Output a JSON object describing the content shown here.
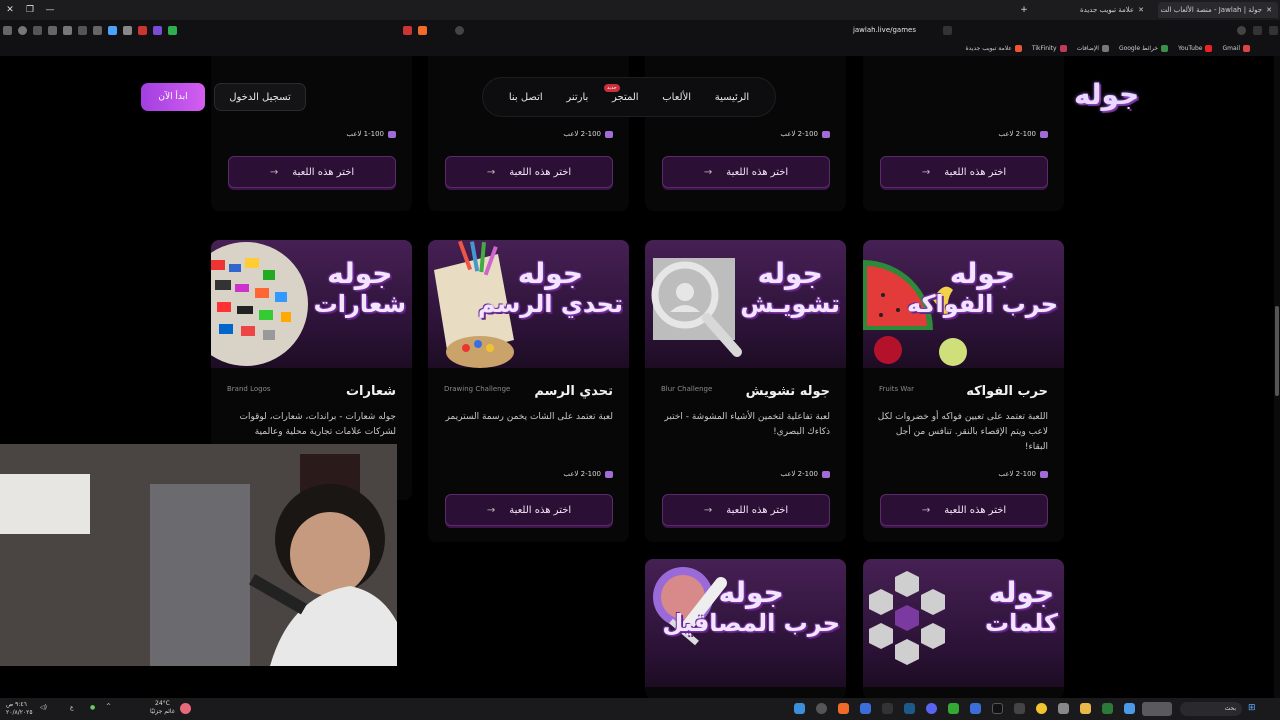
{
  "browser": {
    "active_tab_title": "جولة | Jawlah - منصة الألعاب الت",
    "other_tab_title": "علامة تبويب جديدة",
    "address": "jawlah.live/games",
    "bookmarks": [
      "Gmail",
      "YouTube",
      "خرائط Google",
      "الإضافات",
      "TikFinity",
      "علامة تبويب جديدة"
    ]
  },
  "header": {
    "brand": "جوله",
    "nav": [
      "الرئيسية",
      "الألعاب",
      "المتجر",
      "بارتنر",
      "اتصل بنا"
    ],
    "store_badge": "جديد",
    "login_label": "تسجيل الدخول",
    "start_label": "ابدأ الآن"
  },
  "choose_label": "اختر هذه اللعبة",
  "top_row": [
    {
      "players": "1-100 لاعب"
    },
    {
      "players": "2-100 لاعب"
    },
    {
      "players": "2-100 لاعب"
    },
    {
      "players": "2-100 لاعب"
    }
  ],
  "games": [
    {
      "title": "حرب الفواكه",
      "en": "Fruits War",
      "logo_line1": "جوله",
      "logo_line2": "حرب الفواكه",
      "desc": "اللعبة تعتمد على تعيين فواكه أو خضروات لكل لاعب ويتم الإقصاء بالنقر. تنافس من أجل البقاء!",
      "players": "2-100 لاعب"
    },
    {
      "title": "جوله تشويش",
      "en": "Blur Challenge",
      "logo_line1": "جوله",
      "logo_line2": "تشويـش",
      "desc": "لعبة تفاعلية لتخمين الأشياء المشوشة - اختبر ذكاءك البصري!",
      "players": "2-100 لاعب"
    },
    {
      "title": "تحدي الرسم",
      "en": "Drawing Challenge",
      "logo_line1": "جوله",
      "logo_line2": "تحدي الرسم",
      "desc": "لعبة تعتمد على الشات يخمن رسمة الستريمر",
      "players": "2-100 لاعب"
    },
    {
      "title": "شعارات",
      "en": "Brand Logos",
      "logo_line1": "جوله",
      "logo_line2": "شعارات",
      "desc": "جوله شعارات - براندات، شعارات، لوقوات لشركات علامات تجارية محلية وعالمية",
      "players": ""
    }
  ],
  "bottom_row": [
    {
      "logo_line1": "جوله",
      "logo_line2": "كلمات"
    },
    {
      "logo_line1": "جوله",
      "logo_line2": "حرب المصاقيل"
    }
  ],
  "taskbar": {
    "weather_temp": "24°C",
    "weather_desc": "غائم جزئيًا",
    "time": "٩:٤٦ ص",
    "date": "٢٠/٨/٢٠٢٥",
    "search_label": "بحث"
  },
  "colors": {
    "accent": "#b35ef0",
    "button_bg": "#2c0f35",
    "card_bg": "#070707"
  }
}
